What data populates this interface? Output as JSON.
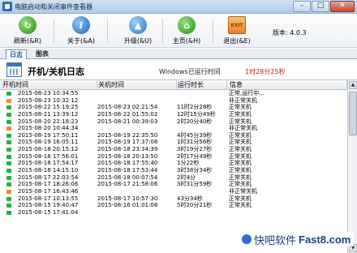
{
  "window": {
    "title": "电脑启动和关闭事件查看器",
    "minimize_glyph": "–",
    "maximize_glyph": "□",
    "close_glyph": "✕"
  },
  "toolbar": {
    "buttons": [
      {
        "label": "刷新(&R)",
        "icon": "refresh-icon",
        "glyph": "↻"
      },
      {
        "label": "关于(&A)",
        "icon": "about-icon",
        "glyph": "i"
      },
      {
        "label": "升级(&U)",
        "icon": "upgrade-icon",
        "glyph": "▲"
      },
      {
        "label": "主页(&H)",
        "icon": "home-icon",
        "glyph": "⌂"
      },
      {
        "label": "退出(&E)",
        "icon": "exit-icon",
        "glyph": "EXIT"
      }
    ],
    "version": "版本: 4.0.3"
  },
  "tabs": [
    "日志",
    "图表"
  ],
  "panel": {
    "title": "开机/关机日志",
    "run_label": "Windows已运行时间",
    "run_value": "1时28分25秒"
  },
  "table": {
    "headers": [
      "开机时间",
      "关机时间",
      "运行时长",
      "信息"
    ],
    "rows": [
      {
        "status": "green",
        "start": "2015-08-23 10:34:55",
        "end": "",
        "duration": "",
        "info": "正常,运行中..."
      },
      {
        "status": "orange",
        "start": "2015-08-23 10:32:12",
        "end": "",
        "duration": "",
        "info": "非正常关机"
      },
      {
        "status": "green",
        "start": "2015-08-22 15:19:25",
        "end": "2015-08-23 02:21:54",
        "duration": "11时2分28秒",
        "info": "正常关机"
      },
      {
        "status": "green",
        "start": "2015-08-21 13:39:12",
        "end": "2015-08-22 01:55:02",
        "duration": "12时15分49秒",
        "info": "正常关机"
      },
      {
        "status": "green",
        "start": "2015-08-20 22:18:23",
        "end": "2015-08-21 00:39:03",
        "duration": "2时20分40秒",
        "info": "正常关机"
      },
      {
        "status": "orange",
        "start": "2015-08-20 10:44:34",
        "end": "",
        "duration": "",
        "info": "非正常关机"
      },
      {
        "status": "green",
        "start": "2015-08-19 17:50:11",
        "end": "2015-08-19 22:35:50",
        "duration": "4时45分39秒",
        "info": "正常关机"
      },
      {
        "status": "green",
        "start": "2015-08-19 16:05:11",
        "end": "2015-08-19 17:37:08",
        "duration": "1时31分56秒",
        "info": "正常关机"
      },
      {
        "status": "green",
        "start": "2015-08-18 20:15:12",
        "end": "2015-08-18 23:34:39",
        "duration": "3时19分27秒",
        "info": "正常关机"
      },
      {
        "status": "green",
        "start": "2015-08-18 17:56:01",
        "end": "2015-08-18 20:13:50",
        "duration": "2时17分49秒",
        "info": "正常关机"
      },
      {
        "status": "green",
        "start": "2015-08-18 17:54:17",
        "end": "2015-08-18 17:55:40",
        "duration": "1分22秒",
        "info": "正常关机"
      },
      {
        "status": "green",
        "start": "2015-08-18 14:15:10",
        "end": "2015-08-18 17:53:44",
        "duration": "3时38分34秒",
        "info": "正常关机"
      },
      {
        "status": "green",
        "start": "2015-08-17 22:03:54",
        "end": "2015-08-18 00:07:54",
        "duration": "2时4分",
        "info": "正常关机"
      },
      {
        "status": "green",
        "start": "2015-08-17 18:26:06",
        "end": "2015-08-17 21:58:06",
        "duration": "3时31分59秒",
        "info": "正常关机"
      },
      {
        "status": "orange",
        "start": "2015-08-17 16:43:46",
        "end": "",
        "duration": "",
        "info": "非正常关机"
      },
      {
        "status": "green",
        "start": "2015-08-17 10:13:55",
        "end": "2015-08-17 10:57:30",
        "duration": "43分34秒",
        "info": "正常关机"
      },
      {
        "status": "green",
        "start": "2015-08-15 19:40:47",
        "end": "2015-08-16 01:01:08",
        "duration": "5时20分21秒",
        "info": "正常关机"
      },
      {
        "status": "green",
        "start": "2015-08-15 17:41:04",
        "end": "",
        "duration": "",
        "info": ""
      }
    ]
  },
  "watermark": {
    "text": "快吧软件",
    "site": "Fast8.com"
  },
  "colors": {
    "status_green": "#21b24a",
    "status_orange": "#f08a24",
    "run_value": "#c8151b"
  }
}
